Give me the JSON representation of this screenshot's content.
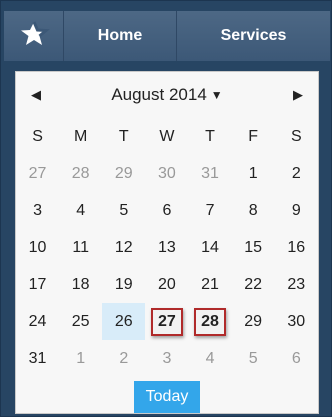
{
  "nav": {
    "logo_icon": "star-logo-icon",
    "home_label": "Home",
    "services_label": "Services"
  },
  "calendar": {
    "month_label": "August 2014",
    "weekdays": [
      "S",
      "M",
      "T",
      "W",
      "T",
      "F",
      "S"
    ],
    "weeks": [
      [
        "27",
        "28",
        "29",
        "30",
        "31",
        "1",
        "2"
      ],
      [
        "3",
        "4",
        "5",
        "6",
        "7",
        "8",
        "9"
      ],
      [
        "10",
        "11",
        "12",
        "13",
        "14",
        "15",
        "16"
      ],
      [
        "17",
        "18",
        "19",
        "20",
        "21",
        "22",
        "23"
      ],
      [
        "24",
        "25",
        "26",
        "27",
        "28",
        "29",
        "30"
      ],
      [
        "31",
        "1",
        "2",
        "3",
        "4",
        "5",
        "6"
      ]
    ],
    "other_month": [
      [
        true,
        true,
        true,
        true,
        true,
        false,
        false
      ],
      [
        false,
        false,
        false,
        false,
        false,
        false,
        false
      ],
      [
        false,
        false,
        false,
        false,
        false,
        false,
        false
      ],
      [
        false,
        false,
        false,
        false,
        false,
        false,
        false
      ],
      [
        false,
        false,
        false,
        false,
        false,
        false,
        false
      ],
      [
        false,
        true,
        true,
        true,
        true,
        true,
        true
      ]
    ],
    "today": {
      "week": 4,
      "day": 2
    },
    "selected": [
      {
        "week": 4,
        "day": 3
      },
      {
        "week": 4,
        "day": 4
      }
    ],
    "today_button_label": "Today"
  },
  "colors": {
    "frame": "#274563",
    "nav_bar": "#4d6885",
    "today_highlight": "#d8ecf9",
    "selected_border": "#b02a2a",
    "today_button": "#33a6ea"
  }
}
